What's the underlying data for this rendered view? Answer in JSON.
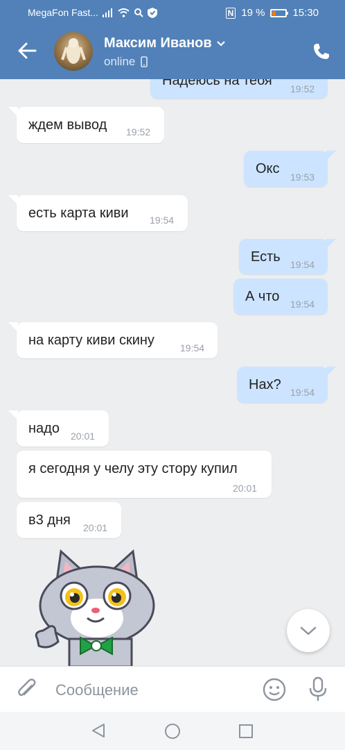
{
  "statusbar": {
    "carrier": "MegaFon Fast...",
    "battery": "19 %",
    "time": "15:30",
    "nfc": "N"
  },
  "header": {
    "contact_name": "Максим Иванов",
    "status": "online"
  },
  "messages": [
    {
      "dir": "out",
      "text": "Надеюсь на тебя",
      "time": "19:52"
    },
    {
      "dir": "in",
      "text": "ждем вывод",
      "time": "19:52"
    },
    {
      "dir": "out",
      "text": "Окс",
      "time": "19:53"
    },
    {
      "dir": "in",
      "text": "есть карта киви",
      "time": "19:54"
    },
    {
      "dir": "out",
      "text": "Есть",
      "time": "19:54"
    },
    {
      "dir": "out",
      "text": "А что",
      "time": "19:54"
    },
    {
      "dir": "in",
      "text": "на карту киви скину",
      "time": "19:54"
    },
    {
      "dir": "out",
      "text": "Нах?",
      "time": "19:54"
    },
    {
      "dir": "in",
      "text": "надо",
      "time": "20:01"
    },
    {
      "dir": "in",
      "text": "я сегодня у челу эту стору купил",
      "time": "20:01"
    },
    {
      "dir": "in",
      "text": "в3 дня",
      "time": "20:01"
    }
  ],
  "sticker": {
    "icon": "cat-sticker-icon"
  },
  "composer": {
    "placeholder": "Сообщение"
  },
  "colors": {
    "header": "#5181b8",
    "incoming": "#ffffff",
    "outgoing": "#cce4ff",
    "background": "#edeef0"
  }
}
